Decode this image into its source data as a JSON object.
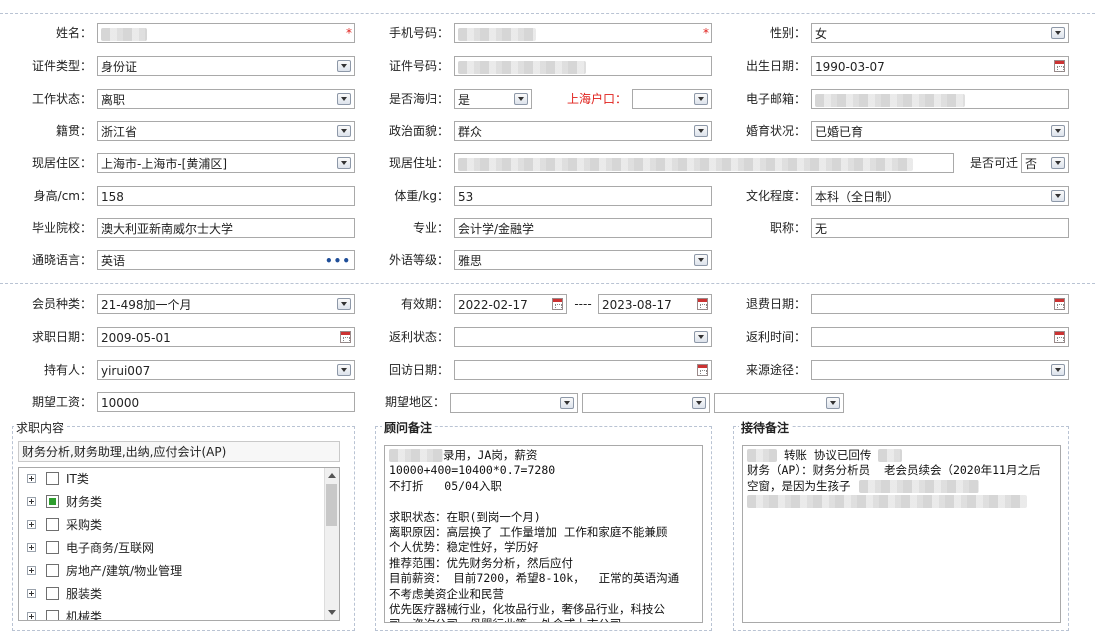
{
  "basic": {
    "name_label": "姓名：",
    "mobile_label": "手机号码：",
    "gender_label": "性别：",
    "gender_value": "女",
    "id_type_label": "证件类型：",
    "id_type_value": "身份证",
    "id_no_label": "证件号码：",
    "birth_label": "出生日期：",
    "birth_value": "1990-03-07",
    "work_status_label": "工作状态：",
    "work_status_value": "离职",
    "returnee_label": "是否海归：",
    "returnee_value": "是",
    "hukou_label": "上海户口：",
    "email_label": "电子邮箱：",
    "native_label": "籍贯：",
    "native_value": "浙江省",
    "political_label": "政治面貌：",
    "political_value": "群众",
    "marital_label": "婚育状况：",
    "marital_value": "已婚已育",
    "district_label": "现居住区：",
    "district_value": "上海市-上海市-[黄浦区]",
    "address_label": "现居住址：",
    "relocate_label": "是否可迁",
    "relocate_value": "否",
    "height_label": "身高/cm：",
    "height_value": "158",
    "weight_label": "体重/kg：",
    "weight_value": "53",
    "education_label": "文化程度：",
    "education_value": "本科（全日制）",
    "school_label": "毕业院校：",
    "school_value": "澳大利亚新南威尔士大学",
    "major_label": "专业：",
    "major_value": "会计学/金融学",
    "title_label": "职称：",
    "title_value": "无",
    "language_label": "通晓语言：",
    "language_value": "英语",
    "language_more": "•••",
    "foreign_level_label": "外语等级：",
    "foreign_level_value": "雅思",
    "required_mark": "*"
  },
  "membership": {
    "type_label": "会员种类：",
    "type_value": "21-498加一个月",
    "valid_label": "有效期：",
    "valid_from": "2022-02-17",
    "valid_sep": "----",
    "valid_to": "2023-08-17",
    "refund_date_label": "退费日期：",
    "job_date_label": "求职日期：",
    "job_date_value": "2009-05-01",
    "rebate_status_label": "返利状态：",
    "rebate_time_label": "返利时间：",
    "holder_label": "持有人：",
    "holder_value": "yirui007",
    "visit_date_label": "回访日期：",
    "source_label": "来源途径：",
    "salary_label": "期望工资：",
    "salary_value": "10000",
    "region_label": "期望地区："
  },
  "job_panel": {
    "title": "求职内容",
    "summary": "财务分析,财务助理,出纳,应付会计(AP)",
    "tree": [
      {
        "label": "IT类",
        "checked": false
      },
      {
        "label": "财务类",
        "checked": true
      },
      {
        "label": "采购类",
        "checked": false
      },
      {
        "label": "电子商务/互联网",
        "checked": false
      },
      {
        "label": "房地产/建筑/物业管理",
        "checked": false
      },
      {
        "label": "服装类",
        "checked": false
      },
      {
        "label": "机械类",
        "checked": false
      }
    ]
  },
  "consultant": {
    "title": "顾问备注",
    "line1": "录用，JA岗，薪资10000+400=10400*0.7=7280",
    "body": "不打折   05/04入职\n\n求职状态：在职(到岗一个月)\n离职原因：高层换了 工作量增加 工作和家庭不能兼顾\n个人优势：稳定性好，学历好\n推荐范围：优先财务分析，然后应付\n目前薪资： 目前7200，希望8-10k，  正常的英语沟通\n不考虑美资企业和民营\n优先医疗器械行业，化妆品行业，奢侈品行业，科技公\n司，咨询公司，母婴行业等  外企或上市公司"
  },
  "reception": {
    "title": "接待备注",
    "line1": "转账 协议已回传",
    "body": "财务（AP）：财务分析员  老会员续会（2020年11月之后\n空窗，是因为生孩子"
  },
  "colors": {
    "accent_red": "#e0201b",
    "border": "#a9a9a9",
    "dashed": "#b9c3d3",
    "check_green": "#2e9e2e"
  }
}
